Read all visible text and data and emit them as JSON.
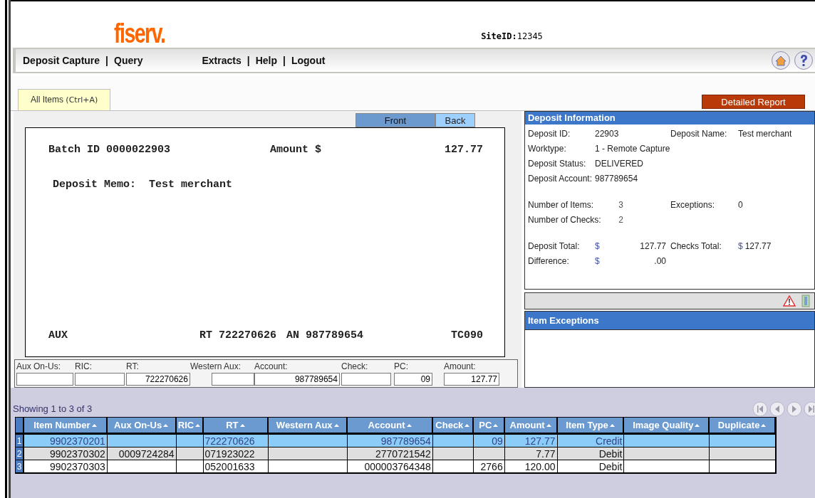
{
  "header": {
    "logo": "fiserv.",
    "site_id": "**SiteID:**12345"
  },
  "nav": {
    "items": [
      {
        "label": "Deposit Capture",
        "separator": "|"
      },
      {
        "label": "Query"
      },
      {
        "label": "Extracts",
        "separator": "|"
      },
      {
        "label": "Help",
        "separator": "|"
      },
      {
        "label": "Logout"
      }
    ]
  },
  "tabs": [
    {
      "label": "All Items",
      "shortcut": "(Ctrl+A)",
      "selected": true
    }
  ],
  "detailed_report_button": "Detailed Report",
  "image_tabs": [
    {
      "label": "Front",
      "selected": true
    },
    {
      "label": "Back",
      "selected": false
    }
  ],
  "check_image": {
    "batch_label": "Batch ID",
    "batch_id": "0000022903",
    "amount_label": "Amount $",
    "amount": "127.77",
    "memo_label": "Deposit Memo:",
    "memo": "Test merchant",
    "micr": [
      {
        "label": "AUX"
      },
      {
        "label": "RT",
        "value": "722270626"
      },
      {
        "label": "AN",
        "value": "987789654"
      },
      {
        "label": "TC",
        "value": "090"
      }
    ]
  },
  "fields": [
    {
      "label": "Aux On-Us:"
    },
    {
      "label": "RIC:"
    },
    {
      "label": "RT:",
      "value": "722270626"
    },
    {
      "label": "Western Aux:"
    },
    {
      "label": "Account:",
      "value": "987789654"
    },
    {
      "label": "Check:"
    },
    {
      "label": "PC:",
      "value": "09"
    },
    {
      "label": "Amount:",
      "value": "127.77"
    }
  ],
  "deposit_information": {
    "title": "Deposit Information",
    "sections": [
      [
        [
          {
            "label": "Deposit ID:",
            "value": "22903"
          },
          {
            "label": "Deposit Name:",
            "value": "Test merchant"
          }
        ],
        [
          {
            "label": "Worktype:",
            "value": "1 - Remote Capture"
          }
        ],
        [
          {
            "label": "Deposit Status:",
            "value": "DELIVERED"
          }
        ],
        [
          {
            "label": "Deposit Account:",
            "value": "987789654"
          }
        ]
      ],
      [
        [
          {
            "label": "Number of Items:",
            "value": "3",
            "kind": "count"
          },
          {
            "label": "Exceptions:",
            "value": "0"
          }
        ],
        [
          {
            "label": "Number of Checks:",
            "value": "2",
            "kind": "count"
          }
        ]
      ],
      [
        [
          {
            "label": "Deposit Total:",
            "value": "127.77",
            "symbol": "$",
            "kind": "money"
          },
          {
            "label": "Checks Total:",
            "value": "127.77",
            "symbol": "$"
          }
        ],
        [
          {
            "label": "Difference:",
            "value": ".00",
            "symbol": "$",
            "kind": "money"
          }
        ]
      ]
    ]
  },
  "item_exceptions": {
    "title": "Item Exceptions"
  },
  "grid": {
    "showing": "Showing 1 to 3 of 3",
    "columns": [
      "Item Number",
      "Aux On-Us",
      "RIC",
      "RT",
      "Western Aux",
      "Account",
      "Check",
      "PC",
      "Amount",
      "Item Type",
      "Image Quality",
      "Duplicate"
    ],
    "rows": [
      {
        "index": "1",
        "selected": true,
        "cells": [
          "9902370201",
          "",
          "",
          "722270626",
          "",
          "987789654",
          "",
          "09",
          "127.77",
          "Credit",
          "",
          ""
        ]
      },
      {
        "index": "2",
        "selected": false,
        "cells": [
          "9902370302",
          "0009724284",
          "",
          "071923022",
          "",
          "2770721542",
          "",
          "",
          "7.77",
          "Debit",
          "",
          ""
        ]
      },
      {
        "index": "3",
        "selected": false,
        "cells": [
          "9902370303",
          "",
          "",
          "052001633",
          "",
          "000003764348",
          "",
          "2766",
          "120.00",
          "Debit",
          "",
          ""
        ]
      }
    ]
  }
}
